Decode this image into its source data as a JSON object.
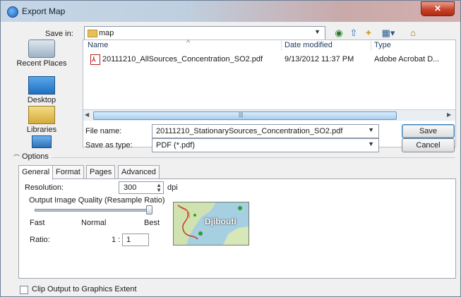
{
  "window": {
    "title": "Export Map",
    "close_glyph": "✕"
  },
  "save_in": {
    "label": "Save in:",
    "value": "map"
  },
  "places": [
    {
      "label": "Recent Places",
      "icon": "recent-places-icon"
    },
    {
      "label": "Desktop",
      "icon": "desktop-icon"
    },
    {
      "label": "Libraries",
      "icon": "libraries-icon"
    }
  ],
  "file_list": {
    "columns": [
      "Name",
      "Date modified",
      "Type"
    ],
    "rows": [
      {
        "name": "20111210_AllSources_Concentration_SO2.pdf",
        "date": "9/13/2012 11:37 PM",
        "type": "Adobe Acrobat D..."
      }
    ]
  },
  "file_name": {
    "label": "File name:",
    "value": "20111210_StationarySources_Concentration_SO2.pdf"
  },
  "save_as_type": {
    "label": "Save as type:",
    "value": "PDF (*.pdf)"
  },
  "buttons": {
    "save": "Save",
    "cancel": "Cancel"
  },
  "options": {
    "label": "Options"
  },
  "tabs": [
    "General",
    "Format",
    "Pages",
    "Advanced"
  ],
  "general": {
    "resolution_label": "Resolution:",
    "resolution_value": "300",
    "resolution_unit": "dpi",
    "quality_title": "Output Image Quality (Resample Ratio)",
    "quality_slider_level": 1.0,
    "slider_marks": [
      "Fast",
      "Normal",
      "Best"
    ],
    "ratio_label": "Ratio:",
    "ratio_prefix": "1 :",
    "ratio_value": "1",
    "map_preview_label": "Djibouti"
  },
  "clip_output": {
    "label": "Clip Output to Graphics Extent",
    "checked": false
  }
}
